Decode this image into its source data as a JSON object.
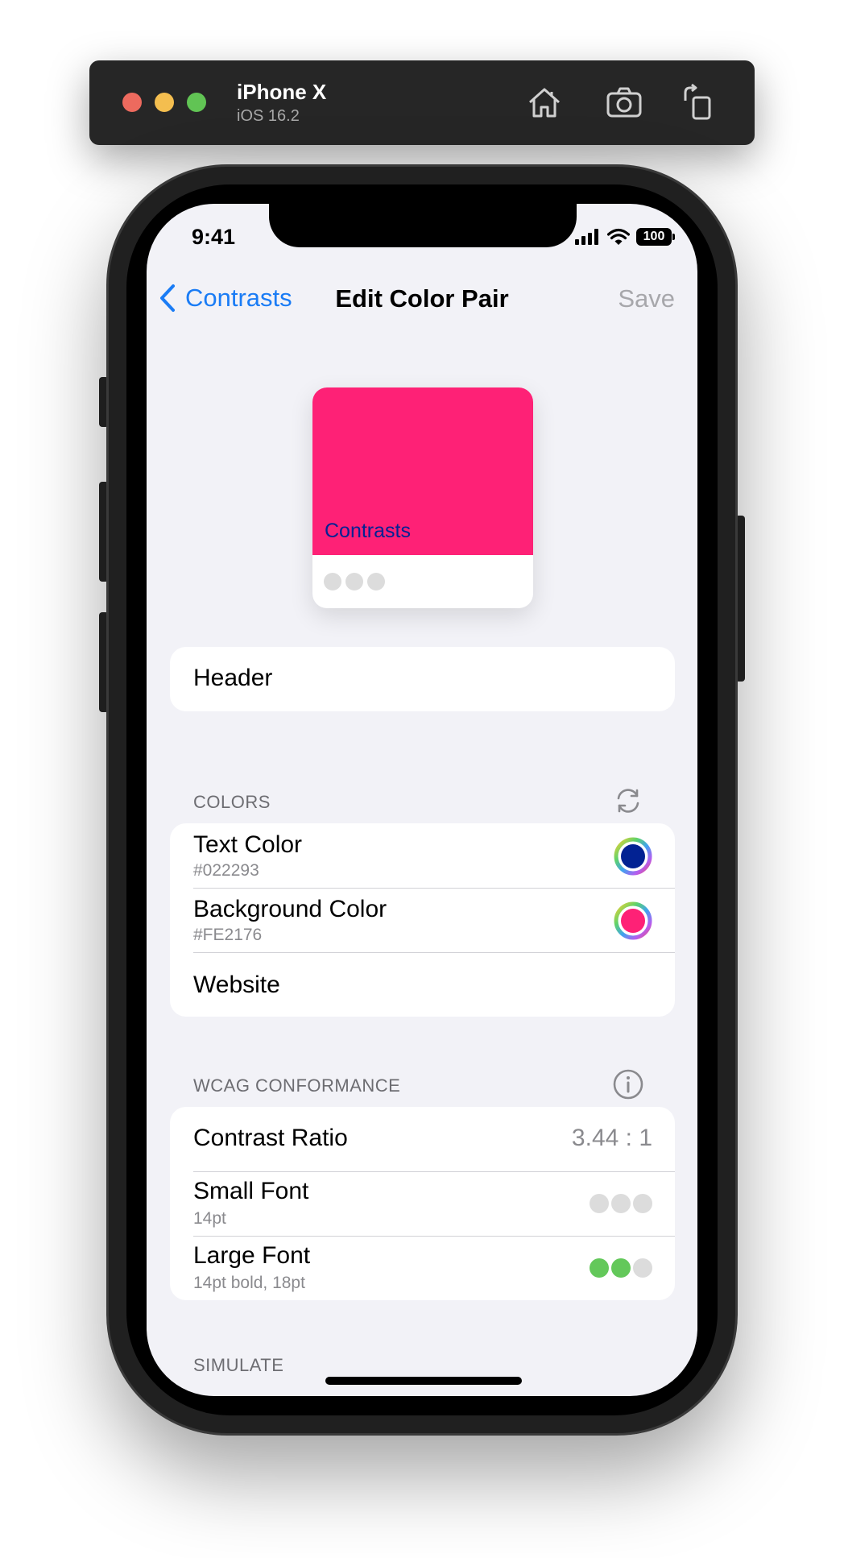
{
  "simulator": {
    "device_name": "iPhone X",
    "os_version": "iOS 16.2",
    "toolbar_icons": [
      "home-icon",
      "screenshot-icon",
      "rotate-icon"
    ]
  },
  "status_bar": {
    "time": "9:41",
    "battery": "100",
    "icons": [
      "cellular-signal-icon",
      "wifi-icon",
      "battery-icon"
    ]
  },
  "nav": {
    "back_label": "Contrasts",
    "title": "Edit Color Pair",
    "save_label": "Save"
  },
  "preview": {
    "sample_text": "Contrasts",
    "foreground": "#022293",
    "background": "#FE2176",
    "dots": 3
  },
  "header_field": {
    "value": "Header"
  },
  "colors_section": {
    "title": "COLORS",
    "icon": "refresh-icon",
    "rows": [
      {
        "title": "Text Color",
        "subtitle": "#022293",
        "swatch": "#022293"
      },
      {
        "title": "Background Color",
        "subtitle": "#FE2176",
        "swatch": "#FE2176"
      },
      {
        "title": "Website"
      }
    ]
  },
  "wcag_section": {
    "title": "WCAG CONFORMANCE",
    "icon": "info-icon",
    "contrast_ratio": {
      "label": "Contrast Ratio",
      "value": "3.44 : 1"
    },
    "small_font": {
      "label": "Small Font",
      "subtitle": "14pt",
      "passed": 0,
      "total": 3
    },
    "large_font": {
      "label": "Large Font",
      "subtitle": "14pt bold, 18pt",
      "passed": 2,
      "total": 3
    }
  },
  "simulate_section": {
    "title": "SIMULATE"
  },
  "colors": {
    "accent": "#1A7CF5",
    "pass": "#63C85A",
    "fail": "#DCDCDC",
    "grouped_background": "#F2F2F7"
  }
}
